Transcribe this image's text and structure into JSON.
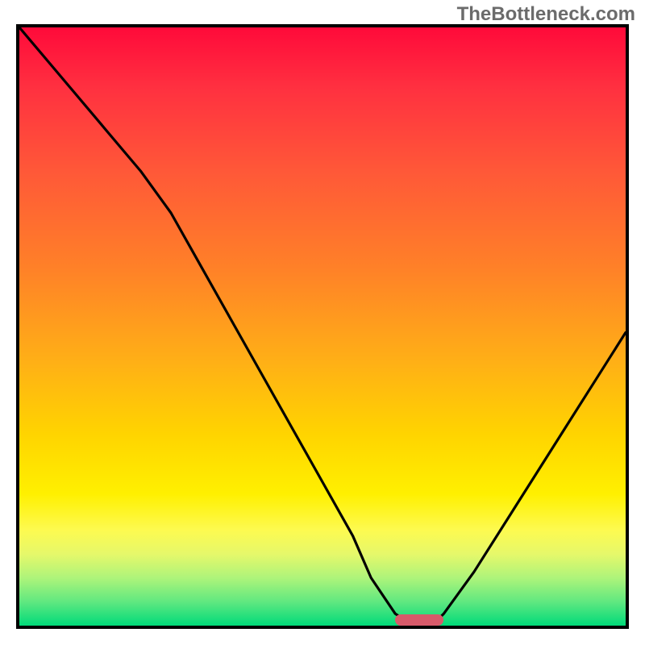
{
  "watermark": "TheBottleneck.com",
  "colors": {
    "frame_border": "#000000",
    "marker": "#d85a6a",
    "gradient_top": "#ff0a3a",
    "gradient_bottom": "#00da7a"
  },
  "chart_data": {
    "type": "line",
    "title": "",
    "xlabel": "",
    "ylabel": "",
    "xlim": [
      0,
      100
    ],
    "ylim": [
      0,
      100
    ],
    "x": [
      0,
      5,
      10,
      15,
      20,
      25,
      30,
      35,
      40,
      45,
      50,
      55,
      58,
      62,
      65,
      68,
      70,
      75,
      80,
      85,
      90,
      95,
      100
    ],
    "values": [
      100,
      94,
      88,
      82,
      76,
      69,
      60,
      51,
      42,
      33,
      24,
      15,
      8,
      2,
      0,
      0,
      2,
      9,
      17,
      25,
      33,
      41,
      49
    ],
    "marker": {
      "x_start": 62,
      "x_end": 70,
      "y": 0
    },
    "background_gradient": {
      "orientation": "vertical",
      "stops": [
        {
          "pos": 0.0,
          "color": "#ff0a3a"
        },
        {
          "pos": 0.24,
          "color": "#ff5838"
        },
        {
          "pos": 0.56,
          "color": "#ffb016"
        },
        {
          "pos": 0.78,
          "color": "#fff000"
        },
        {
          "pos": 0.92,
          "color": "#aef47a"
        },
        {
          "pos": 1.0,
          "color": "#00da7a"
        }
      ]
    }
  }
}
